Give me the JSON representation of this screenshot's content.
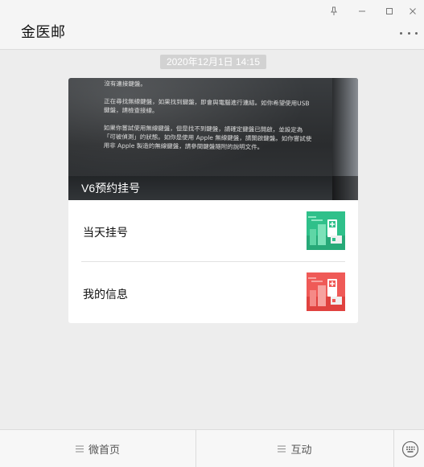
{
  "window": {
    "title": "金医邮",
    "icons": {
      "pin": "pin-icon",
      "minimize": "minimize-icon",
      "maximize": "maximize-icon",
      "close": "close-icon",
      "more": "more-icon"
    }
  },
  "chat": {
    "timestamp": "2020年12月1日 14:15",
    "card": {
      "cover_caption": "V6预约挂号",
      "cover_screen_text": "沒有連接鍵盤。\n\n正在尋找無線鍵盤，如果找到鍵盤，即會與電腦進行連結。如你希望使用USB\n鍵盤，請檢查接線。\n\n如果你嘗試使用無線鍵盤，但是找不到鍵盤，請確定鍵盤已開啟，並設定為\n「可被偵測」的狀態。如你是使用 Apple 無線鍵盤，請開啟鍵盤。如你嘗試使\n用非 Apple 製造的無線鍵盤，請參閱鍵盤隨附的說明文件。",
      "items": [
        {
          "label": "当天挂号",
          "thumb_color": "#2fc08a",
          "thumb_icon": "hospital-building-icon"
        },
        {
          "label": "我的信息",
          "thumb_color": "#ef5a57",
          "thumb_icon": "hospital-building-icon"
        }
      ]
    }
  },
  "bottom_menu": {
    "tabs": [
      {
        "label": "微首页",
        "icon": "menu-lines-icon"
      },
      {
        "label": "互动",
        "icon": "menu-lines-icon"
      }
    ],
    "keyboard_icon": "keyboard-icon"
  }
}
